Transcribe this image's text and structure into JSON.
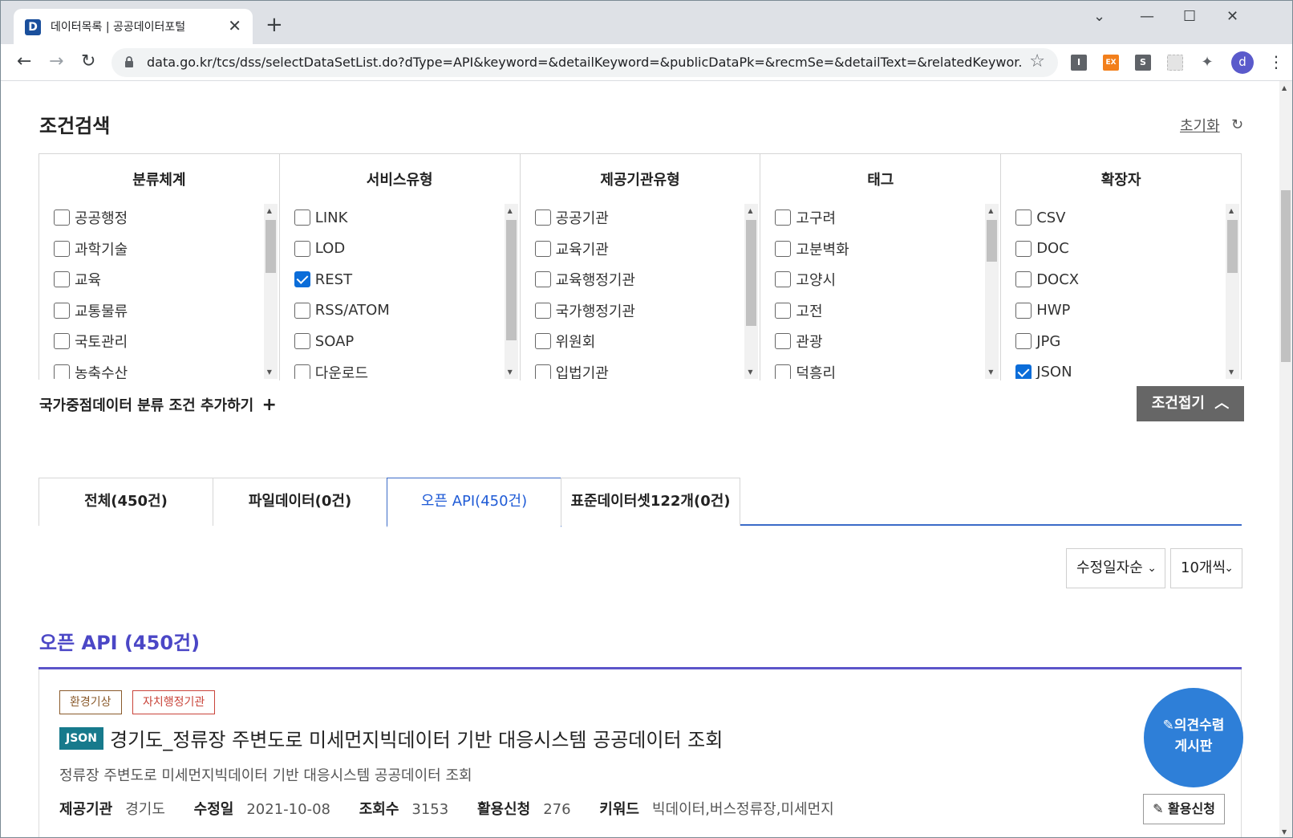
{
  "browser": {
    "tab_title": "데이터목록 | 공공데이터포털",
    "favicon_letter": "D",
    "url": "data.go.kr/tcs/dss/selectDataSetList.do?dType=API&keyword=&detailKeyword=&publicDataPk=&recmSe=&detailText=&relatedKeywor...",
    "profile_initial": "d",
    "extensions": [
      {
        "name": "extension-i-icon",
        "label": "I",
        "color": "#5f6368"
      },
      {
        "name": "extension-ex-icon",
        "label": "EX",
        "color": "#f27f1b"
      },
      {
        "name": "extension-s-icon",
        "label": "S",
        "color": "#5f6368"
      },
      {
        "name": "extension-pattern-icon",
        "label": "",
        "color": "#d7d7d7"
      },
      {
        "name": "extensions-puzzle-icon",
        "label": "",
        "color": "#5f6368"
      }
    ]
  },
  "search": {
    "title": "조건검색",
    "reset_label": "초기화",
    "columns": [
      {
        "header": "분류체계",
        "items": [
          {
            "label": "공공행정",
            "checked": false
          },
          {
            "label": "과학기술",
            "checked": false
          },
          {
            "label": "교육",
            "checked": false
          },
          {
            "label": "교통물류",
            "checked": false
          },
          {
            "label": "국토관리",
            "checked": false
          },
          {
            "label": "농축수산",
            "checked": false
          }
        ]
      },
      {
        "header": "서비스유형",
        "items": [
          {
            "label": "LINK",
            "checked": false
          },
          {
            "label": "LOD",
            "checked": false
          },
          {
            "label": "REST",
            "checked": true
          },
          {
            "label": "RSS/ATOM",
            "checked": false
          },
          {
            "label": "SOAP",
            "checked": false
          },
          {
            "label": "다운로드",
            "checked": false
          }
        ]
      },
      {
        "header": "제공기관유형",
        "items": [
          {
            "label": "공공기관",
            "checked": false
          },
          {
            "label": "교육기관",
            "checked": false
          },
          {
            "label": "교육행정기관",
            "checked": false
          },
          {
            "label": "국가행정기관",
            "checked": false
          },
          {
            "label": "위원회",
            "checked": false
          },
          {
            "label": "입법기관",
            "checked": false
          }
        ]
      },
      {
        "header": "태그",
        "items": [
          {
            "label": "고구려",
            "checked": false
          },
          {
            "label": "고분벽화",
            "checked": false
          },
          {
            "label": "고양시",
            "checked": false
          },
          {
            "label": "고전",
            "checked": false
          },
          {
            "label": "관광",
            "checked": false
          },
          {
            "label": "덕흥리",
            "checked": false
          }
        ]
      },
      {
        "header": "확장자",
        "items": [
          {
            "label": "CSV",
            "checked": false
          },
          {
            "label": "DOC",
            "checked": false
          },
          {
            "label": "DOCX",
            "checked": false
          },
          {
            "label": "HWP",
            "checked": false
          },
          {
            "label": "JPG",
            "checked": false
          },
          {
            "label": "JSON",
            "checked": true
          }
        ]
      }
    ],
    "add_condition_label": "국가중점데이터 분류 조건 추가하기",
    "collapse_label": "조건접기"
  },
  "result_tabs": [
    {
      "label": "전체(450건)",
      "active": false
    },
    {
      "label": "파일데이터(0건)",
      "active": false
    },
    {
      "label": "오픈 API(450건)",
      "active": true
    },
    {
      "label": "표준데이터셋122개(0건)",
      "active": false
    }
  ],
  "sort": {
    "selected": "수정일자순"
  },
  "page_size": {
    "selected": "10개씩"
  },
  "results": {
    "heading": "오픈 API (450건)",
    "items": [
      {
        "badges": [
          {
            "label": "환경기상",
            "color": "#8a5a2b"
          },
          {
            "label": "자치행정기관",
            "color": "#c9443a"
          }
        ],
        "format": "JSON",
        "title": "경기도_정류장 주변도로 미세먼지빅데이터 기반 대응시스템 공공데이터 조회",
        "description": "정류장 주변도로 미세먼지빅데이터 기반 대응시스템 공공데이터 조회",
        "provider_label": "제공기관",
        "provider": "경기도",
        "modified_label": "수정일",
        "modified": "2021-10-08",
        "views_label": "조회수",
        "views": "3153",
        "applications_label": "활용신청",
        "applications": "276",
        "keywords_label": "키워드",
        "keywords": "빅데이터,버스정류장,미세먼지",
        "apply_label": "활용신청"
      }
    ]
  },
  "feedback_fab": {
    "line1": "의견수렴",
    "line2": "게시판"
  }
}
